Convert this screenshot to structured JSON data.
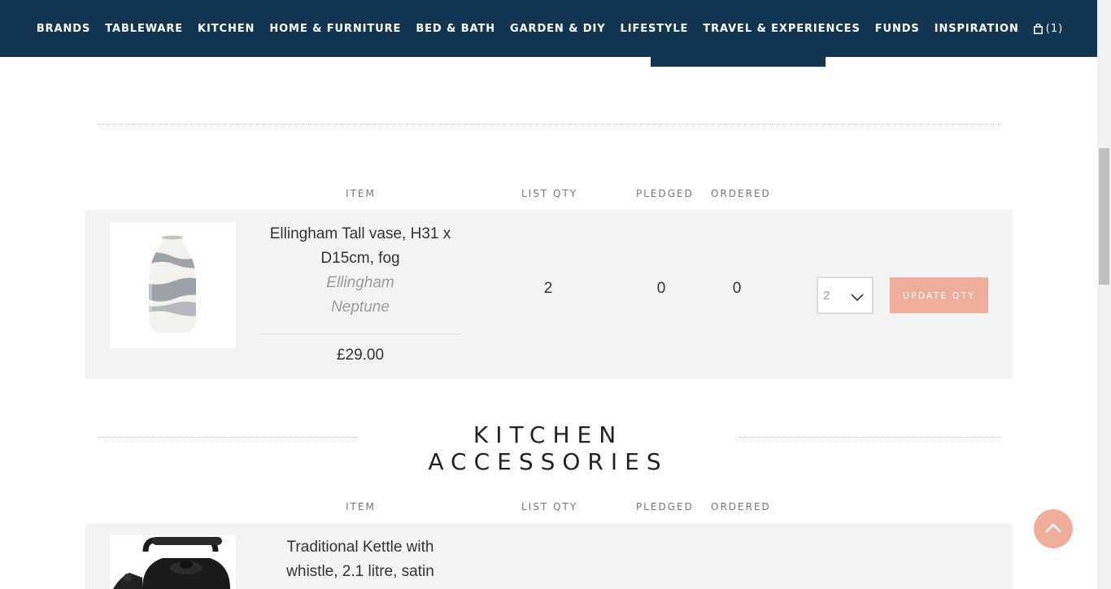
{
  "nav": {
    "items": [
      "BRANDS",
      "TABLEWARE",
      "KITCHEN",
      "HOME & FURNITURE",
      "BED & BATH",
      "GARDEN & DIY",
      "LIFESTYLE",
      "TRAVEL & EXPERIENCES",
      "FUNDS",
      "INSPIRATION"
    ],
    "cart_count": "(1)",
    "bg_color": "#123552"
  },
  "table_headers": {
    "item": "ITEM",
    "list_qty": "LIST QTY",
    "pledged": "PLEDGED",
    "ordered": "ORDERED"
  },
  "row1": {
    "name_line1": "Ellingham Tall vase, H31 x",
    "name_line2": "D15cm, fog",
    "brand": "Ellingham",
    "collection": "Neptune",
    "price": "£29.00",
    "list_qty": "2",
    "pledged": "0",
    "ordered": "0",
    "select_value": "2",
    "update_label": "UPDATE QTY"
  },
  "section": {
    "title": "KITCHEN ACCESSORIES"
  },
  "row2": {
    "name_line1": "Traditional Kettle with",
    "name_line2": "whistle, 2.1 litre, satin"
  },
  "accent_color": "#efae9c"
}
